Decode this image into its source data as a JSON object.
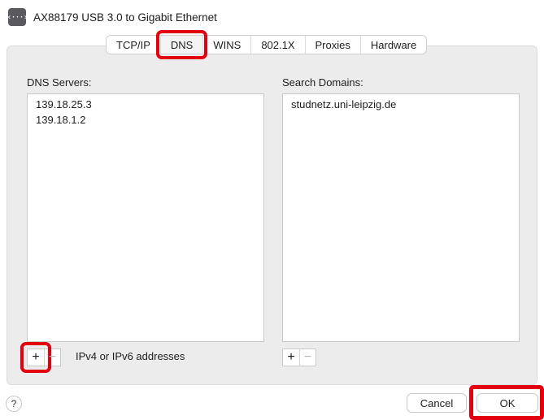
{
  "header": {
    "icon": "network-interface-icon",
    "icon_glyph": "‹···›",
    "title": "AX88179 USB 3.0 to Gigabit Ethernet"
  },
  "tabs": [
    {
      "label": "TCP/IP",
      "active": false
    },
    {
      "label": "DNS",
      "active": true
    },
    {
      "label": "WINS",
      "active": false
    },
    {
      "label": "802.1X",
      "active": false
    },
    {
      "label": "Proxies",
      "active": false
    },
    {
      "label": "Hardware",
      "active": false
    }
  ],
  "dns": {
    "label": "DNS Servers:",
    "servers": [
      "139.18.25.3",
      "139.18.1.2"
    ],
    "hint": "IPv4 or IPv6 addresses"
  },
  "search": {
    "label": "Search Domains:",
    "domains": [
      "studnetz.uni-leipzig.de"
    ]
  },
  "controls": {
    "plus": "+",
    "minus": "−",
    "help": "?",
    "cancel": "Cancel",
    "ok": "OK"
  },
  "colors": {
    "highlight": "#e3000f",
    "panel": "#ececec"
  }
}
